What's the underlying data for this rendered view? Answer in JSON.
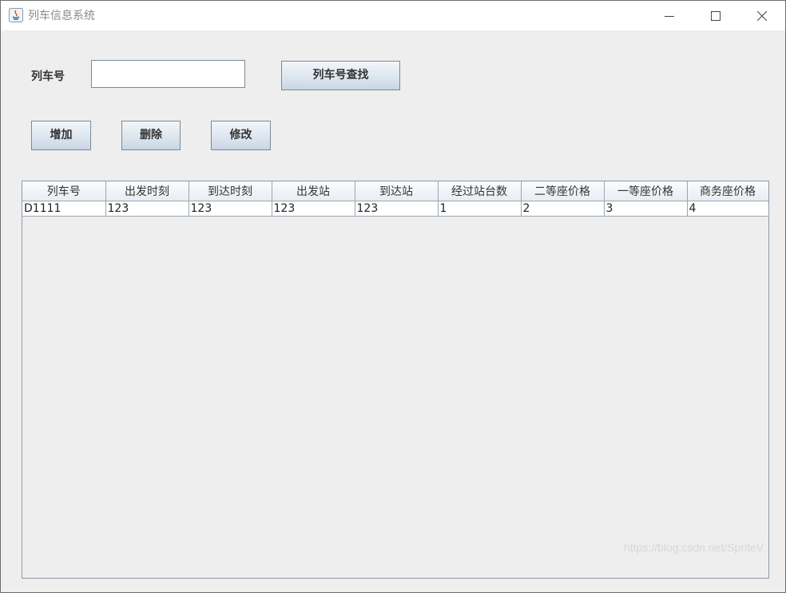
{
  "window": {
    "title": "列车信息系统"
  },
  "search": {
    "label": "列车号",
    "value": "",
    "button_label": "列车号查找"
  },
  "actions": {
    "add_label": "增加",
    "delete_label": "删除",
    "modify_label": "修改"
  },
  "table": {
    "columns": [
      "列车号",
      "出发时刻",
      "到达时刻",
      "出发站",
      "到达站",
      "经过站台数",
      "二等座价格",
      "一等座价格",
      "商务座价格"
    ],
    "rows": [
      [
        "D1111",
        "123",
        "123",
        "123",
        "123",
        "1",
        "2",
        "3",
        "4"
      ]
    ]
  },
  "watermark": "https://blog.csdn.net/SpriteV",
  "colors": {
    "window_bg": "#eeeeee",
    "titlebar_bg": "#ffffff",
    "button_gradient_top": "#f2f6fa",
    "button_gradient_bottom": "#c9d6e3",
    "border": "#7a8a99"
  }
}
